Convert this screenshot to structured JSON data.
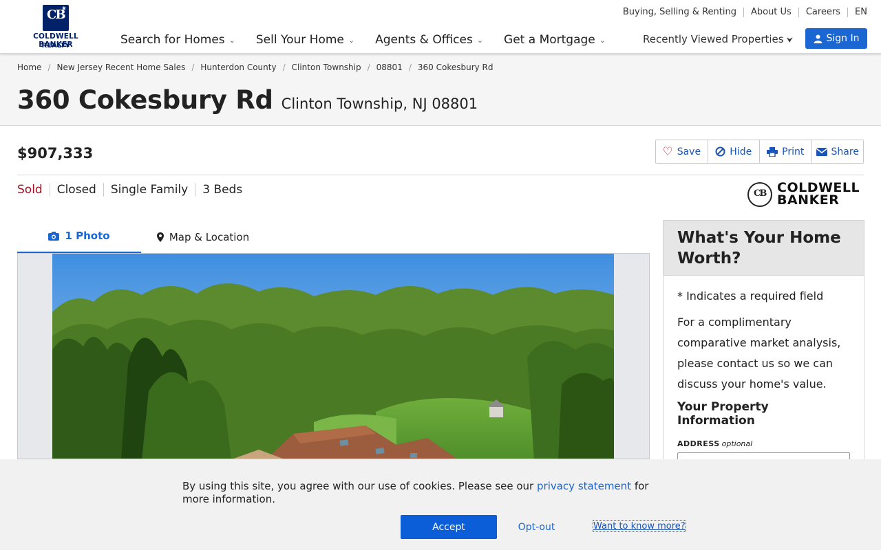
{
  "header": {
    "logo_line1": "COLDWELL BANKER",
    "logo_line2": "REALTY",
    "logo_mark": "CB",
    "nav": [
      "Search for Homes",
      "Sell Your Home",
      "Agents & Offices",
      "Get a Mortgage"
    ],
    "utility": [
      "Buying, Selling & Renting",
      "About Us",
      "Careers",
      "EN"
    ],
    "recently_viewed": "Recently Viewed Properties",
    "sign_in": "Sign In"
  },
  "breadcrumbs": [
    "Home",
    "New Jersey Recent Home Sales",
    "Hunterdon County",
    "Clinton Township",
    "08801",
    "360 Cokesbury Rd"
  ],
  "listing": {
    "street": "360 Cokesbury Rd",
    "city_state_zip": "Clinton Township, NJ 08801",
    "price": "$907,333",
    "tags": [
      "Sold",
      "Closed",
      "Single Family",
      "3 Beds"
    ],
    "brand_logo_line1": "COLDWELL",
    "brand_logo_line2": "BANKER"
  },
  "actions": [
    "Save",
    "Hide",
    "Print",
    "Share"
  ],
  "tabs": [
    "1 Photo",
    "Map & Location"
  ],
  "sidebar": {
    "title": "What's Your Home Worth?",
    "required_note": "* Indicates a required field",
    "description": "For a complimentary comparative market analysis, please contact us so we can discuss your home's value.",
    "section_title": "Your Property Information",
    "address_label": "ADDRESS",
    "address_hint": "optional"
  },
  "cookie": {
    "text_before": "By using this site, you agree with our use of cookies. Please see our ",
    "link": "privacy statement",
    "text_after": " for more information.",
    "accept": "Accept",
    "optout": "Opt-out",
    "know_more": "Want to know more?"
  },
  "colors": {
    "brand_navy": "#012169",
    "link_blue": "#1a66d2",
    "sold_red": "#a50d1f"
  }
}
